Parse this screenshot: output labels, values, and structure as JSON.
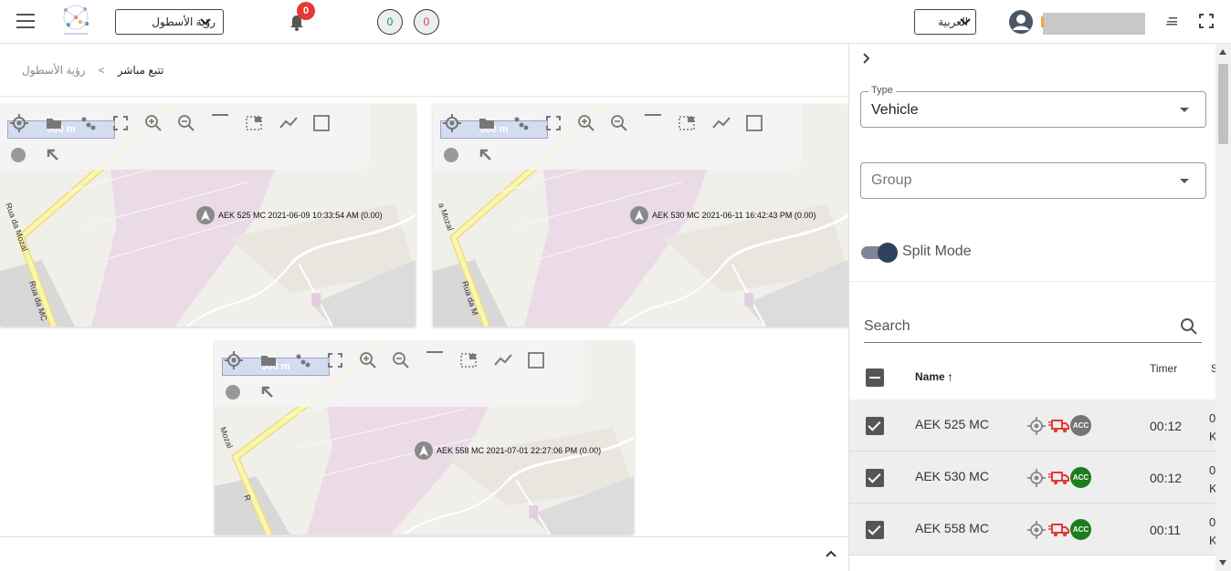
{
  "topbar": {
    "fleet_view_label": "رؤية الأسطول",
    "notification_count": "0",
    "counter_green": "0",
    "counter_red": "0",
    "language_label": "العربية"
  },
  "breadcrumb": {
    "root": "رؤية الأسطول",
    "separator": "<",
    "current": "تتبع مباشر"
  },
  "maps": [
    {
      "scale_label": "500 m",
      "vehicle_label": "AEK 525 MC 2021-06-09 10:33:54 AM (0.00)",
      "street_a": "Rua da Mozal",
      "street_b": "Rua da MC"
    },
    {
      "scale_label": "500 m",
      "vehicle_label": "AEK 530 MC 2021-06-11 16:42:43 PM (0.00)",
      "street_a": "a Mozal",
      "street_b": "Rua da M"
    },
    {
      "scale_label": "500 m",
      "vehicle_label": "AEK 558 MC 2021-07-01 22:27:06 PM (0.00)",
      "street_a": "Mozal",
      "street_b": "R"
    }
  ],
  "sidebar": {
    "type_legend": "Type",
    "type_value": "Vehicle",
    "group_placeholder": "Group",
    "split_mode_label": "Split Mode",
    "search_placeholder": "Search",
    "col_name": "Name",
    "col_sort_arrow": "↑",
    "col_timer": "Timer",
    "col_truncated": "S",
    "rows": [
      {
        "name": "AEK 525 MC",
        "acc_label": "ACC",
        "acc_color": "#757575",
        "timer": "00:12",
        "truncated": "0 K"
      },
      {
        "name": "AEK 530 MC",
        "acc_label": "ACC",
        "acc_color": "#1b7d1b",
        "timer": "00:12",
        "truncated": "0 K"
      },
      {
        "name": "AEK 558 MC",
        "acc_label": "ACC",
        "acc_color": "#1b7d1b",
        "timer": "00:11",
        "truncated": "0 K"
      }
    ]
  },
  "colors": {
    "badge_red": "#e53935",
    "counter_green": "#1b8f2c",
    "truck_red": "#e53935",
    "toggle_knob": "#2e4260"
  },
  "icons": [
    "menu-icon",
    "logo-icon",
    "bell-icon",
    "avatar-icon",
    "sort-icon",
    "fullscreen-icon",
    "chevron-right-icon",
    "search-icon",
    "target-icon",
    "truck-icon",
    "chevron-up-icon"
  ]
}
